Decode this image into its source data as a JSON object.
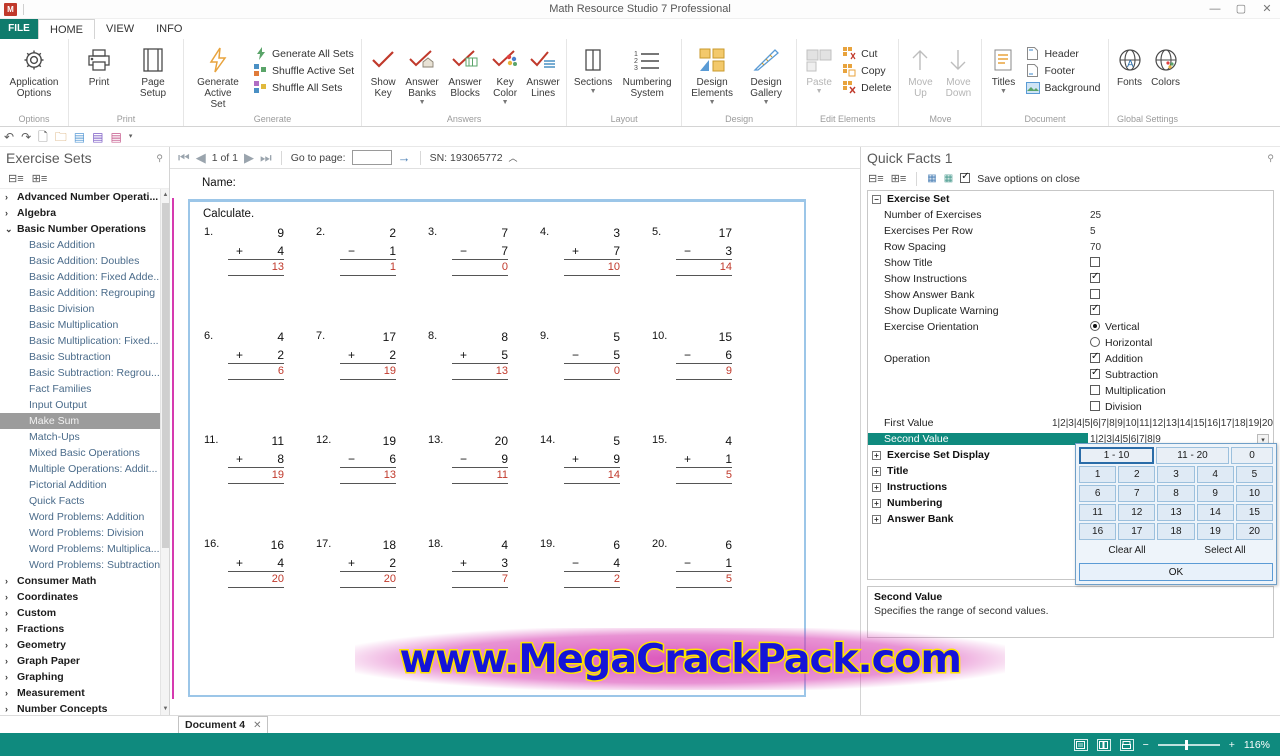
{
  "window": {
    "title": "Math Resource Studio 7 Professional",
    "logo_text": "M",
    "minimize": "—",
    "maximize": "▢",
    "close": "✕"
  },
  "quick_access": {
    "icons": [
      "undo-icon",
      "redo-icon",
      "new-document-icon",
      "open-folder-icon",
      "save-icon",
      "save-as-icon",
      "save-all-icon",
      "customize-caret-icon"
    ]
  },
  "ribbon": {
    "tabs": [
      {
        "label": "FILE",
        "active": false
      },
      {
        "label": "HOME",
        "active": true
      },
      {
        "label": "VIEW",
        "active": false
      },
      {
        "label": "INFO",
        "active": false
      }
    ],
    "groups": [
      {
        "label": "Options",
        "buttons": [
          {
            "label": "Application\nOptions",
            "line1": "Application",
            "line2": "Options",
            "icon": "gear-icon",
            "caret": false,
            "disabled": false
          }
        ]
      },
      {
        "label": "Print",
        "buttons": [
          {
            "line1": "Print",
            "line2": "",
            "icon": "printer-icon",
            "caret": false,
            "disabled": false
          },
          {
            "line1": "Page",
            "line2": "Setup",
            "icon": "page-setup-icon",
            "caret": false,
            "disabled": false
          }
        ]
      },
      {
        "label": "Generate",
        "buttons": [
          {
            "line1": "Generate Active",
            "line2": "Set",
            "icon": "lightning-icon",
            "caret": false,
            "disabled": false
          }
        ],
        "small_items": [
          {
            "label": "Generate All Sets",
            "icon": "generate-all-icon"
          },
          {
            "label": "Shuffle Active Set",
            "icon": "shuffle-active-icon"
          },
          {
            "label": "Shuffle All Sets",
            "icon": "shuffle-all-icon"
          }
        ]
      },
      {
        "label": "Answers",
        "buttons": [
          {
            "line1": "Show",
            "line2": "Key",
            "icon": "check-key-icon",
            "caret": false,
            "disabled": false
          },
          {
            "line1": "Answer",
            "line2": "Banks",
            "icon": "answer-banks-icon",
            "caret": true,
            "disabled": false
          },
          {
            "line1": "Answer",
            "line2": "Blocks",
            "icon": "answer-blocks-icon",
            "caret": false,
            "disabled": false
          },
          {
            "line1": "Key",
            "line2": "Color",
            "icon": "key-color-icon",
            "caret": true,
            "disabled": false
          },
          {
            "line1": "Answer",
            "line2": "Lines",
            "icon": "answer-lines-icon",
            "caret": false,
            "disabled": false
          }
        ]
      },
      {
        "label": "Layout",
        "buttons": [
          {
            "line1": "Sections",
            "line2": "",
            "icon": "sections-icon",
            "caret": true,
            "disabled": false
          },
          {
            "line1": "Numbering",
            "line2": "System",
            "icon": "numbering-system-icon",
            "caret": false,
            "disabled": false
          }
        ]
      },
      {
        "label": "Design",
        "buttons": [
          {
            "line1": "Design",
            "line2": "Elements",
            "icon": "design-elements-icon",
            "caret": true,
            "disabled": false
          },
          {
            "line1": "Design",
            "line2": "Gallery",
            "icon": "design-gallery-icon",
            "caret": true,
            "disabled": false
          }
        ]
      },
      {
        "label": "Edit Elements",
        "buttons": [
          {
            "line1": "Paste",
            "line2": "",
            "icon": "paste-icon",
            "caret": true,
            "disabled": true
          }
        ],
        "small_items": [
          {
            "label": "Cut",
            "icon": "cut-icon"
          },
          {
            "label": "Copy",
            "icon": "copy-icon"
          },
          {
            "label": "Delete",
            "icon": "delete-icon"
          }
        ]
      },
      {
        "label": "Move",
        "buttons": [
          {
            "line1": "Move",
            "line2": "Up",
            "icon": "arrow-up-icon",
            "caret": false,
            "disabled": true
          },
          {
            "line1": "Move",
            "line2": "Down",
            "icon": "arrow-down-icon",
            "caret": false,
            "disabled": true
          }
        ]
      },
      {
        "label": "Document",
        "buttons": [
          {
            "line1": "Titles",
            "line2": "",
            "icon": "titles-icon",
            "caret": true,
            "disabled": false
          }
        ],
        "small_items": [
          {
            "label": "Header",
            "icon": "header-icon"
          },
          {
            "label": "Footer",
            "icon": "footer-icon"
          },
          {
            "label": "Background",
            "icon": "background-icon"
          }
        ]
      },
      {
        "label": "Global Settings",
        "buttons": [
          {
            "line1": "Fonts",
            "line2": "",
            "icon": "fonts-icon",
            "caret": false,
            "disabled": false
          },
          {
            "line1": "Colors",
            "line2": "",
            "icon": "colors-icon",
            "caret": false,
            "disabled": false
          }
        ]
      }
    ]
  },
  "sidebar": {
    "title": "Exercise Sets",
    "pin_icon": "pin-icon",
    "tools": [
      "collapse-all-icon",
      "expand-all-icon"
    ],
    "nodes": [
      {
        "type": "node",
        "label": "Advanced Number Operati...",
        "expanded": false
      },
      {
        "type": "node",
        "label": "Algebra",
        "expanded": false
      },
      {
        "type": "node",
        "label": "Basic Number Operations",
        "expanded": true
      },
      {
        "type": "leaf",
        "label": "Basic Addition",
        "selected": false
      },
      {
        "type": "leaf",
        "label": "Basic Addition: Doubles",
        "selected": false
      },
      {
        "type": "leaf",
        "label": "Basic Addition: Fixed Adde...",
        "selected": false
      },
      {
        "type": "leaf",
        "label": "Basic Addition: Regrouping",
        "selected": false
      },
      {
        "type": "leaf",
        "label": "Basic Division",
        "selected": false
      },
      {
        "type": "leaf",
        "label": "Basic Multiplication",
        "selected": false
      },
      {
        "type": "leaf",
        "label": "Basic Multiplication: Fixed...",
        "selected": false
      },
      {
        "type": "leaf",
        "label": "Basic Subtraction",
        "selected": false
      },
      {
        "type": "leaf",
        "label": "Basic Subtraction: Regrou...",
        "selected": false
      },
      {
        "type": "leaf",
        "label": "Fact Families",
        "selected": false
      },
      {
        "type": "leaf",
        "label": "Input Output",
        "selected": false
      },
      {
        "type": "leaf",
        "label": "Make Sum",
        "selected": true
      },
      {
        "type": "leaf",
        "label": "Match-Ups",
        "selected": false
      },
      {
        "type": "leaf",
        "label": "Mixed Basic Operations",
        "selected": false
      },
      {
        "type": "leaf",
        "label": "Multiple Operations: Addit...",
        "selected": false
      },
      {
        "type": "leaf",
        "label": "Pictorial Addition",
        "selected": false
      },
      {
        "type": "leaf",
        "label": "Quick Facts",
        "selected": false
      },
      {
        "type": "leaf",
        "label": "Word Problems: Addition",
        "selected": false
      },
      {
        "type": "leaf",
        "label": "Word Problems: Division",
        "selected": false
      },
      {
        "type": "leaf",
        "label": "Word Problems: Multiplica...",
        "selected": false
      },
      {
        "type": "leaf",
        "label": "Word Problems: Subtraction",
        "selected": false
      },
      {
        "type": "node",
        "label": "Consumer Math",
        "expanded": false
      },
      {
        "type": "node",
        "label": "Coordinates",
        "expanded": false
      },
      {
        "type": "node",
        "label": "Custom",
        "expanded": false
      },
      {
        "type": "node",
        "label": "Fractions",
        "expanded": false
      },
      {
        "type": "node",
        "label": "Geometry",
        "expanded": false
      },
      {
        "type": "node",
        "label": "Graph Paper",
        "expanded": false
      },
      {
        "type": "node",
        "label": "Graphing",
        "expanded": false
      },
      {
        "type": "node",
        "label": "Measurement",
        "expanded": false
      },
      {
        "type": "node",
        "label": "Number Concepts",
        "expanded": false
      }
    ]
  },
  "doc_nav": {
    "first_icon": "first-page-icon",
    "prev_icon": "prev-page-icon",
    "page_label": "1 of 1",
    "next_icon": "next-page-icon",
    "last_icon": "last-page-icon",
    "goto_label": "Go to page:",
    "goto_value": "",
    "go_icon": "go-arrow-icon",
    "serial": "SN: 193065772",
    "serial_caret": "chevron-up-icon"
  },
  "document": {
    "name_label": "Name:",
    "instructions": "Calculate.",
    "watermark": "www.MegaCrackPack.com",
    "exercises": [
      {
        "n": "1.",
        "a": "9",
        "op": "+",
        "b": "4",
        "ans": "13"
      },
      {
        "n": "2.",
        "a": "2",
        "op": "−",
        "b": "1",
        "ans": "1"
      },
      {
        "n": "3.",
        "a": "7",
        "op": "−",
        "b": "7",
        "ans": "0"
      },
      {
        "n": "4.",
        "a": "3",
        "op": "+",
        "b": "7",
        "ans": "10"
      },
      {
        "n": "5.",
        "a": "17",
        "op": "−",
        "b": "3",
        "ans": "14"
      },
      {
        "n": "6.",
        "a": "4",
        "op": "+",
        "b": "2",
        "ans": "6"
      },
      {
        "n": "7.",
        "a": "17",
        "op": "+",
        "b": "2",
        "ans": "19"
      },
      {
        "n": "8.",
        "a": "8",
        "op": "+",
        "b": "5",
        "ans": "13"
      },
      {
        "n": "9.",
        "a": "5",
        "op": "−",
        "b": "5",
        "ans": "0"
      },
      {
        "n": "10.",
        "a": "15",
        "op": "−",
        "b": "6",
        "ans": "9"
      },
      {
        "n": "11.",
        "a": "11",
        "op": "+",
        "b": "8",
        "ans": "19"
      },
      {
        "n": "12.",
        "a": "19",
        "op": "−",
        "b": "6",
        "ans": "13"
      },
      {
        "n": "13.",
        "a": "20",
        "op": "−",
        "b": "9",
        "ans": "11"
      },
      {
        "n": "14.",
        "a": "5",
        "op": "+",
        "b": "9",
        "ans": "14"
      },
      {
        "n": "15.",
        "a": "4",
        "op": "+",
        "b": "1",
        "ans": "5"
      },
      {
        "n": "16.",
        "a": "16",
        "op": "+",
        "b": "4",
        "ans": "20"
      },
      {
        "n": "17.",
        "a": "18",
        "op": "+",
        "b": "2",
        "ans": "20"
      },
      {
        "n": "18.",
        "a": "4",
        "op": "+",
        "b": "3",
        "ans": "7"
      },
      {
        "n": "19.",
        "a": "6",
        "op": "−",
        "b": "4",
        "ans": "2"
      },
      {
        "n": "20.",
        "a": "6",
        "op": "−",
        "b": "1",
        "ans": "5"
      }
    ]
  },
  "properties": {
    "title": "Quick Facts 1",
    "pin_icon": "pin-icon",
    "tools": [
      "categorized-icon",
      "alphabetical-icon",
      "load-options-icon",
      "save-options-icon"
    ],
    "save_on_close_label": "Save options on close",
    "save_on_close_checked": true,
    "groups": [
      {
        "label": "Exercise Set",
        "expanded": true,
        "rows": [
          {
            "label": "Number of Exercises",
            "type": "text",
            "value": "25"
          },
          {
            "label": "Exercises Per Row",
            "type": "text",
            "value": "5"
          },
          {
            "label": "Row Spacing",
            "type": "text",
            "value": "70"
          },
          {
            "label": "Show Title",
            "type": "check",
            "checked": false
          },
          {
            "label": "Show Instructions",
            "type": "check",
            "checked": true
          },
          {
            "label": "Show Answer Bank",
            "type": "check",
            "checked": false
          },
          {
            "label": "Show Duplicate Warning",
            "type": "check",
            "checked": true
          },
          {
            "label": "Exercise Orientation",
            "type": "radio",
            "options": [
              {
                "label": "Vertical",
                "checked": true
              },
              {
                "label": "Horizontal",
                "checked": false
              }
            ]
          },
          {
            "label": "Operation",
            "type": "checkgroup",
            "options": [
              {
                "label": "Addition",
                "checked": true
              },
              {
                "label": "Subtraction",
                "checked": true
              },
              {
                "label": "Multiplication",
                "checked": false
              },
              {
                "label": "Division",
                "checked": false
              }
            ]
          },
          {
            "label": "First Value",
            "type": "text",
            "value": "1|2|3|4|5|6|7|8|9|10|11|12|13|14|15|16|17|18|19|20"
          },
          {
            "label": "Second Value",
            "type": "dropdown",
            "value": "1|2|3|4|5|6|7|8|9",
            "selected": true
          }
        ]
      },
      {
        "label": "Exercise Set Display",
        "expanded": false,
        "rows": []
      },
      {
        "label": "Title",
        "expanded": false,
        "rows": []
      },
      {
        "label": "Instructions",
        "expanded": false,
        "rows": []
      },
      {
        "label": "Numbering",
        "expanded": false,
        "rows": []
      },
      {
        "label": "Answer Bank",
        "expanded": false,
        "rows": []
      }
    ],
    "description": {
      "title": "Second Value",
      "text": "Specifies the range of second values."
    }
  },
  "number_picker": {
    "tabs": [
      {
        "label": "1 - 10",
        "active": true
      },
      {
        "label": "11 - 20",
        "active": false
      },
      {
        "label": "0",
        "active": false
      }
    ],
    "rows": [
      [
        "1",
        "2",
        "3",
        "4",
        "5"
      ],
      [
        "6",
        "7",
        "8",
        "9",
        "10"
      ],
      [
        "11",
        "12",
        "13",
        "14",
        "15"
      ],
      [
        "16",
        "17",
        "18",
        "19",
        "20"
      ]
    ],
    "clear_all": "Clear All",
    "select_all": "Select All",
    "ok": "OK",
    "cursor_icon": "mouse-cursor-icon"
  },
  "doc_tabs": [
    {
      "label": "Document 4",
      "close": "✕",
      "active": true
    }
  ],
  "statusbar": {
    "view_icons": [
      "page-view-icon",
      "two-page-view-icon",
      "print-preview-icon"
    ],
    "zoom_out": "−",
    "zoom_in": "+",
    "zoom_level": "116%"
  }
}
